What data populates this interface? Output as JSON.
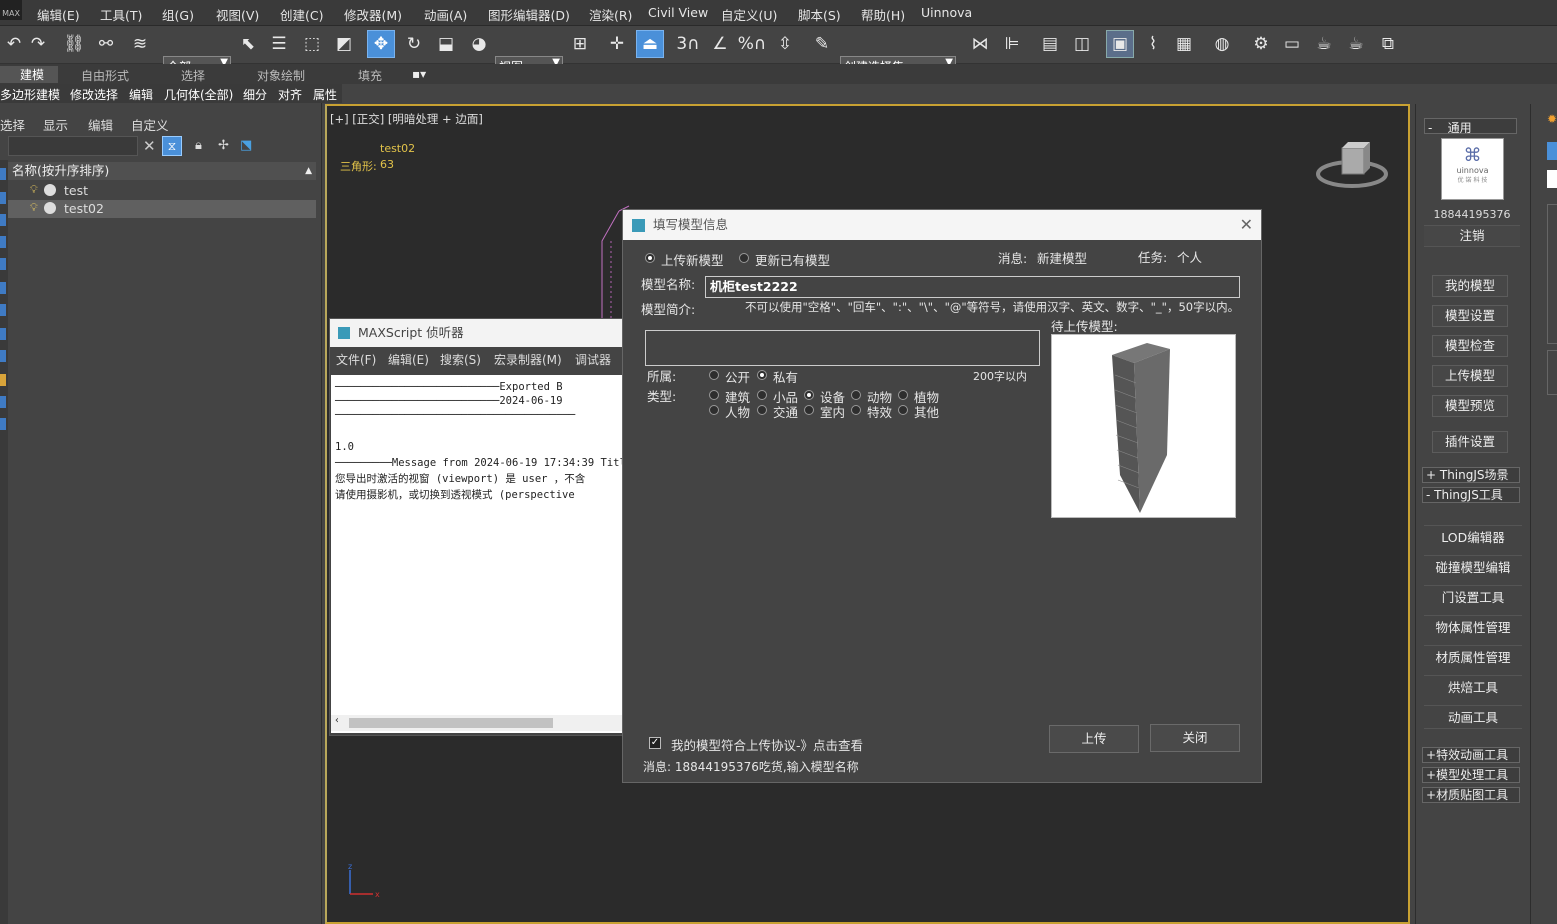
{
  "menubar": {
    "logo": "MAX",
    "items": [
      "编辑(E)",
      "工具(T)",
      "组(G)",
      "视图(V)",
      "创建(C)",
      "修改器(M)",
      "动画(A)",
      "图形编辑器(D)",
      "渲染(R)",
      "Civil View",
      "自定义(U)",
      "脚本(S)",
      "帮助(H)",
      "Uinnova"
    ]
  },
  "toolbar": {
    "filter_combo": "全部",
    "coord_combo": "视图",
    "selset_combo": "创建选择集",
    "snap3": "3",
    "percent": "%"
  },
  "ribbon": {
    "tabs": [
      "建模",
      "自由形式",
      "选择",
      "对象绘制",
      "填充"
    ],
    "subtabs": [
      "多边形建模",
      "修改选择",
      "编辑",
      "几何体(全部)",
      "细分",
      "对齐",
      "属性"
    ]
  },
  "scene_explorer": {
    "tabs": [
      "选择",
      "显示",
      "编辑",
      "自定义"
    ],
    "header": "名称(按升序排序)",
    "rows": [
      {
        "name": "test"
      },
      {
        "name": "test02"
      }
    ]
  },
  "viewport": {
    "label": "[+] [正交] [明暗处理 + 边面]",
    "stat_name": "test02",
    "stat_label": "三角形:",
    "stat_value": "63"
  },
  "listener": {
    "title": "MAXScript 侦听器",
    "menus": [
      "文件(F)",
      "编辑(E)",
      "搜索(S)",
      "宏录制器(M)",
      "调试器"
    ],
    "lines": [
      "──────────────────────────Exported B",
      "──────────────────────────2024-06-19",
      "──────────────────────────────────────",
      "1.0",
      "─────────Message from 2024-06-19 17:34:39  Titl",
      "    您导出时激活的视窗 (viewport) 是 user ，不含",
      "    请使用摄影机，或切换到透视模式 (perspective"
    ]
  },
  "dialog": {
    "title": "填写模型信息",
    "radio_new": "上传新模型",
    "radio_update": "更新已有模型",
    "msg_label": "消息:",
    "msg_value": "新建模型",
    "task_label": "任务:",
    "task_value": "个人",
    "name_label": "模型名称:",
    "name_value": "机柜test2222",
    "desc_label": "模型简介:",
    "hint": "不可以使用\"空格\"、\"回车\"、\":\"、\"\\\"、\"@\"等符号，请使用汉字、英文、数字、\"_\"，50字以内。",
    "preview_label": "待上传模型:",
    "owner_label": "所属:",
    "owner_public": "公开",
    "owner_private": "私有",
    "limit": "200字以内",
    "type_label": "类型:",
    "types": [
      "建筑",
      "小品",
      "设备",
      "动物",
      "植物",
      "人物",
      "交通",
      "室内",
      "特效",
      "其他"
    ],
    "selected_type": "设备",
    "agree": "我的模型符合上传协议-》点击查看",
    "status": "消息: 18844195376吃货,输入模型名称",
    "upload_btn": "上传",
    "close_btn": "关闭"
  },
  "right_panel": {
    "tab": "通用",
    "logo_text": "uinnova",
    "logo_sub": "优 锘 科 技",
    "phone": "18844195376",
    "logout": "注销",
    "buttons": [
      "我的模型",
      "模型设置",
      "模型检查",
      "上传模型",
      "模型预览",
      "插件设置"
    ],
    "sec_scene": "ThingJS场景",
    "sec_tools": "ThingJS工具",
    "tools": [
      "LOD编辑器",
      "碰撞模型编辑",
      "门设置工具",
      "物体属性管理",
      "材质属性管理",
      "烘焙工具",
      "动画工具"
    ],
    "more": [
      "特效动画工具",
      "模型处理工具",
      "材质贴图工具"
    ]
  },
  "colors": {
    "accent": "#4a90d9",
    "viewport_border": "#c8a132",
    "stat_text": "#e2c34a"
  }
}
